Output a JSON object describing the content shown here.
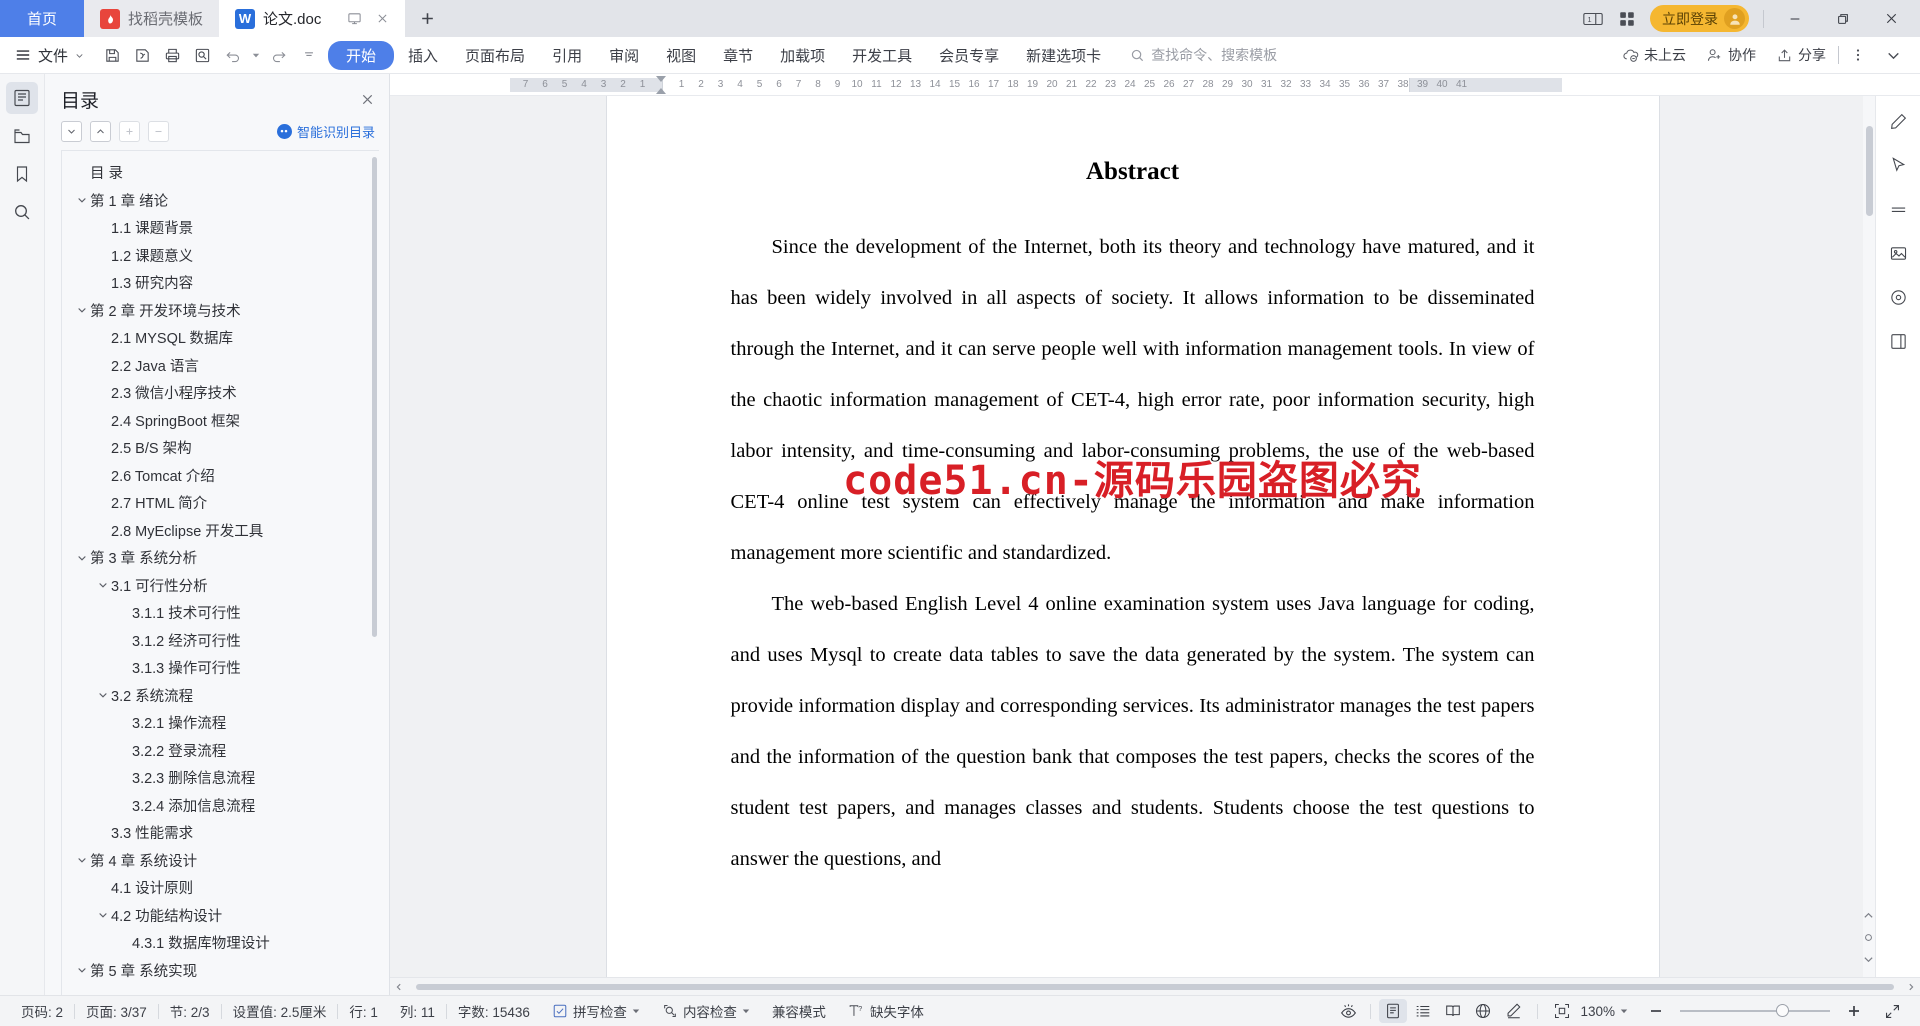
{
  "titlebar": {
    "home_tab": "首页",
    "tabs": [
      {
        "label": "找稻壳模板",
        "icon": "wps-docer-icon",
        "state": "inactive"
      },
      {
        "label": "论文.doc",
        "icon": "word-doc-icon",
        "state": "active"
      }
    ],
    "tab_actions": [
      "present-icon",
      "close-tab-icon"
    ],
    "new_tab": "+",
    "right_icons": [
      "window-split-icon",
      "grid-apps-icon"
    ],
    "login_label": "立即登录",
    "window_controls": [
      "minimize",
      "restore",
      "close"
    ]
  },
  "ribbon": {
    "file_label": "文件",
    "quick_access": [
      "save-icon",
      "save-as-icon",
      "print-icon",
      "print-preview-icon",
      "undo-icon",
      "redo-icon",
      "customize-qat-icon"
    ],
    "tabs": [
      {
        "label": "开始",
        "selected": true
      },
      {
        "label": "插入",
        "selected": false
      },
      {
        "label": "页面布局",
        "selected": false
      },
      {
        "label": "引用",
        "selected": false
      },
      {
        "label": "审阅",
        "selected": false
      },
      {
        "label": "视图",
        "selected": false
      },
      {
        "label": "章节",
        "selected": false
      },
      {
        "label": "加载项",
        "selected": false
      },
      {
        "label": "开发工具",
        "selected": false
      },
      {
        "label": "会员专享",
        "selected": false
      },
      {
        "label": "新建选项卡",
        "selected": false
      }
    ],
    "search_placeholder": "查找命令、搜索模板",
    "right_items": [
      {
        "label": "未上云",
        "icon": "cloud-off-icon"
      },
      {
        "label": "协作",
        "icon": "collaborate-icon"
      },
      {
        "label": "分享",
        "icon": "share-icon"
      }
    ],
    "more_icon": "more-vertical-icon",
    "collapse_icon": "chevron-down-icon"
  },
  "left_rail": [
    {
      "name": "outline-icon",
      "active": true
    },
    {
      "name": "thumbnail-icon",
      "active": false
    },
    {
      "name": "bookmark-icon",
      "active": false
    },
    {
      "name": "search-icon",
      "active": false
    }
  ],
  "toc": {
    "title": "目录",
    "close_icon": "close-icon",
    "tools": [
      {
        "name": "expand-all-button",
        "glyph": "⌄",
        "dim": false
      },
      {
        "name": "collapse-all-button",
        "glyph": "⌃",
        "dim": false
      },
      {
        "name": "increase-level-button",
        "glyph": "+",
        "dim": true
      },
      {
        "name": "decrease-level-button",
        "glyph": "−",
        "dim": true
      }
    ],
    "smart_label": "智能识别目录",
    "items": [
      {
        "text": "目  录",
        "level": 0,
        "caret": ""
      },
      {
        "text": "第 1 章 绪论",
        "level": 0,
        "caret": "down"
      },
      {
        "text": "1.1 课题背景",
        "level": 1,
        "caret": ""
      },
      {
        "text": "1.2 课题意义",
        "level": 1,
        "caret": ""
      },
      {
        "text": "1.3 研究内容",
        "level": 1,
        "caret": ""
      },
      {
        "text": "第 2 章 开发环境与技术",
        "level": 0,
        "caret": "down"
      },
      {
        "text": "2.1 MYSQL 数据库",
        "level": 1,
        "caret": ""
      },
      {
        "text": "2.2 Java 语言",
        "level": 1,
        "caret": ""
      },
      {
        "text": "2.3 微信小程序技术",
        "level": 1,
        "caret": ""
      },
      {
        "text": "2.4 SpringBoot 框架",
        "level": 1,
        "caret": ""
      },
      {
        "text": "2.5 B/S 架构",
        "level": 1,
        "caret": ""
      },
      {
        "text": "2.6 Tomcat 介绍",
        "level": 1,
        "caret": ""
      },
      {
        "text": "2.7 HTML 简介",
        "level": 1,
        "caret": ""
      },
      {
        "text": "2.8 MyEclipse 开发工具",
        "level": 1,
        "caret": ""
      },
      {
        "text": "第 3 章 系统分析",
        "level": 0,
        "caret": "down"
      },
      {
        "text": "3.1 可行性分析",
        "level": 1,
        "caret": "down"
      },
      {
        "text": "3.1.1 技术可行性",
        "level": 2,
        "caret": ""
      },
      {
        "text": "3.1.2 经济可行性",
        "level": 2,
        "caret": ""
      },
      {
        "text": "3.1.3 操作可行性",
        "level": 2,
        "caret": ""
      },
      {
        "text": "3.2 系统流程",
        "level": 1,
        "caret": "down"
      },
      {
        "text": "3.2.1 操作流程",
        "level": 2,
        "caret": ""
      },
      {
        "text": "3.2.2 登录流程",
        "level": 2,
        "caret": ""
      },
      {
        "text": "3.2.3 删除信息流程",
        "level": 2,
        "caret": ""
      },
      {
        "text": "3.2.4 添加信息流程",
        "level": 2,
        "caret": ""
      },
      {
        "text": "3.3 性能需求",
        "level": 1,
        "caret": ""
      },
      {
        "text": "第 4 章 系统设计",
        "level": 0,
        "caret": "down"
      },
      {
        "text": "4.1 设计原则",
        "level": 1,
        "caret": ""
      },
      {
        "text": "4.2 功能结构设计",
        "level": 1,
        "caret": "down"
      },
      {
        "text": "4.3.1 数据库物理设计",
        "level": 2,
        "caret": ""
      },
      {
        "text": "第 5 章 系统实现",
        "level": 0,
        "caret": "down"
      }
    ]
  },
  "ruler": {
    "left_ticks": [
      "7",
      "6",
      "5",
      "4",
      "3",
      "2",
      "1"
    ],
    "right_ticks": [
      "1",
      "2",
      "3",
      "4",
      "5",
      "6",
      "7",
      "8",
      "9",
      "10",
      "11",
      "12",
      "13",
      "14",
      "15",
      "16",
      "17",
      "18",
      "19",
      "20",
      "21",
      "22",
      "23",
      "24",
      "25",
      "26",
      "27",
      "28",
      "29",
      "30",
      "31",
      "32",
      "33",
      "34",
      "35",
      "36",
      "37",
      "38",
      "39",
      "40",
      "41"
    ]
  },
  "document": {
    "heading": "Abstract",
    "watermark": "code51.cn-源码乐园盗图必究",
    "paragraphs": [
      "Since the development of the Internet, both its theory and technology have matured, and it has been widely involved in all aspects of society. It allows information to be disseminated through the Internet, and it can serve people well with information management tools. In view of the chaotic information management of CET-4, high error rate, poor information security, high labor intensity, and time-consuming and labor-consuming problems, the use of the web-based CET-4 online test system can effectively manage the information and make information management more scientific and standardized.",
      "The web-based English Level 4 online examination system uses Java language for coding, and uses Mysql to create data tables to save the data generated by the system. The system can provide information display and corresponding services. Its administrator manages the test papers and the information of the question bank that composes the test papers, checks the scores of the student test papers, and manages classes and students. Students choose the test questions to answer the questions, and"
    ]
  },
  "right_rail": [
    {
      "name": "edit-pen-icon"
    },
    {
      "name": "select-cursor-icon"
    },
    {
      "name": "highlight-icon"
    },
    {
      "name": "image-insert-icon"
    },
    {
      "name": "location-icon"
    },
    {
      "name": "page-layout-icon"
    }
  ],
  "status": {
    "page_number": "页码: 2",
    "page_count": "页面: 3/37",
    "section": "节: 2/3",
    "setting": "设置值: 2.5厘米",
    "row": "行: 1",
    "column": "列: 11",
    "word_count": "字数: 15436",
    "spell_check": "拼写检查",
    "content_check": "内容检查",
    "compat_mode": "兼容模式",
    "missing_font": "缺失字体",
    "eye_icon": "eye-protection-icon",
    "views": [
      {
        "name": "page-view-icon",
        "selected": true
      },
      {
        "name": "outline-view-icon",
        "selected": false
      },
      {
        "name": "reading-view-icon",
        "selected": false
      },
      {
        "name": "web-view-icon",
        "selected": false
      },
      {
        "name": "write-view-icon",
        "selected": false
      }
    ],
    "fit_icon": "fit-page-icon",
    "zoom_level": "130%",
    "zoom_out": "−",
    "zoom_in": "+",
    "fullscreen_icon": "fullscreen-icon"
  },
  "colors": {
    "accent": "#4e7fe8",
    "login": "#f5b731",
    "watermark": "#d81f26",
    "title_bar": "#e2e4e9"
  }
}
